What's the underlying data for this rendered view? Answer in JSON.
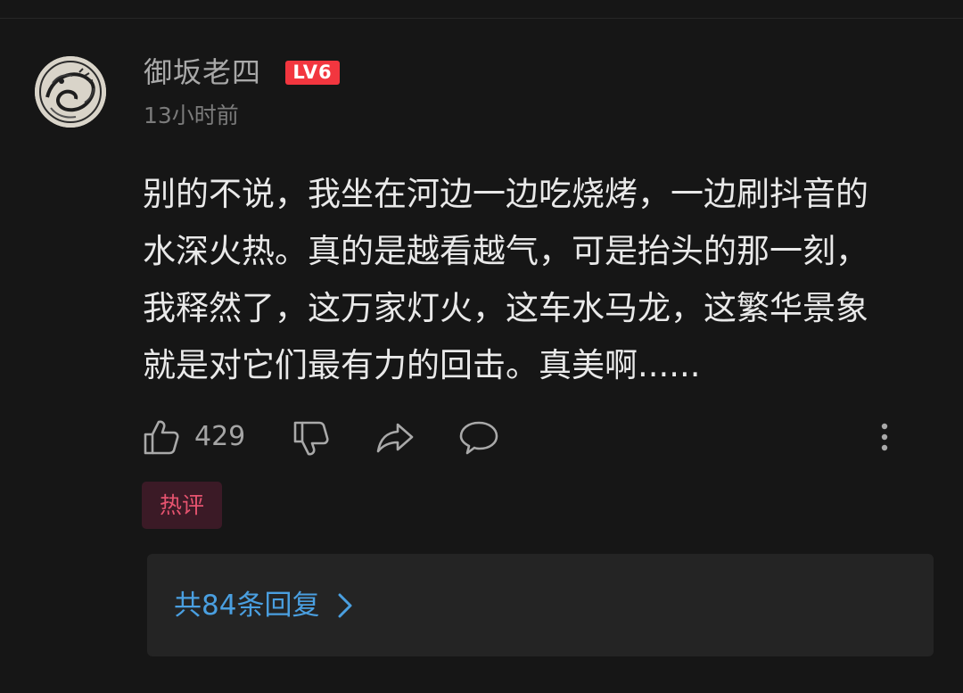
{
  "comment": {
    "author": {
      "name": "御坂老四",
      "level_badge": "LV6",
      "avatar_icon": "avatar-ink-dragon"
    },
    "timestamp": "13小时前",
    "text": "别的不说，我坐在河边一边吃烧烤，一边刷抖音的\n水深火热。真的是越看越气，可是抬头的那一刻，\n我释然了，这万家灯火，这车水马龙，这繁华景象\n就是对它们最有力的回击。真美啊......",
    "actions": {
      "like_count": "429",
      "like_icon": "thumb-up-icon",
      "dislike_icon": "thumb-down-icon",
      "share_icon": "share-arrow-icon",
      "reply_icon": "speech-bubble-icon",
      "more_icon": "vertical-ellipsis-icon"
    },
    "tag": "热评",
    "replies_label": "共84条回复"
  },
  "colors": {
    "background": "#161616",
    "level_badge": "#f2363f",
    "hot_tag_text": "#e5536f",
    "hot_tag_bg": "#3b1a26",
    "reply_link": "#4a9fe0"
  }
}
